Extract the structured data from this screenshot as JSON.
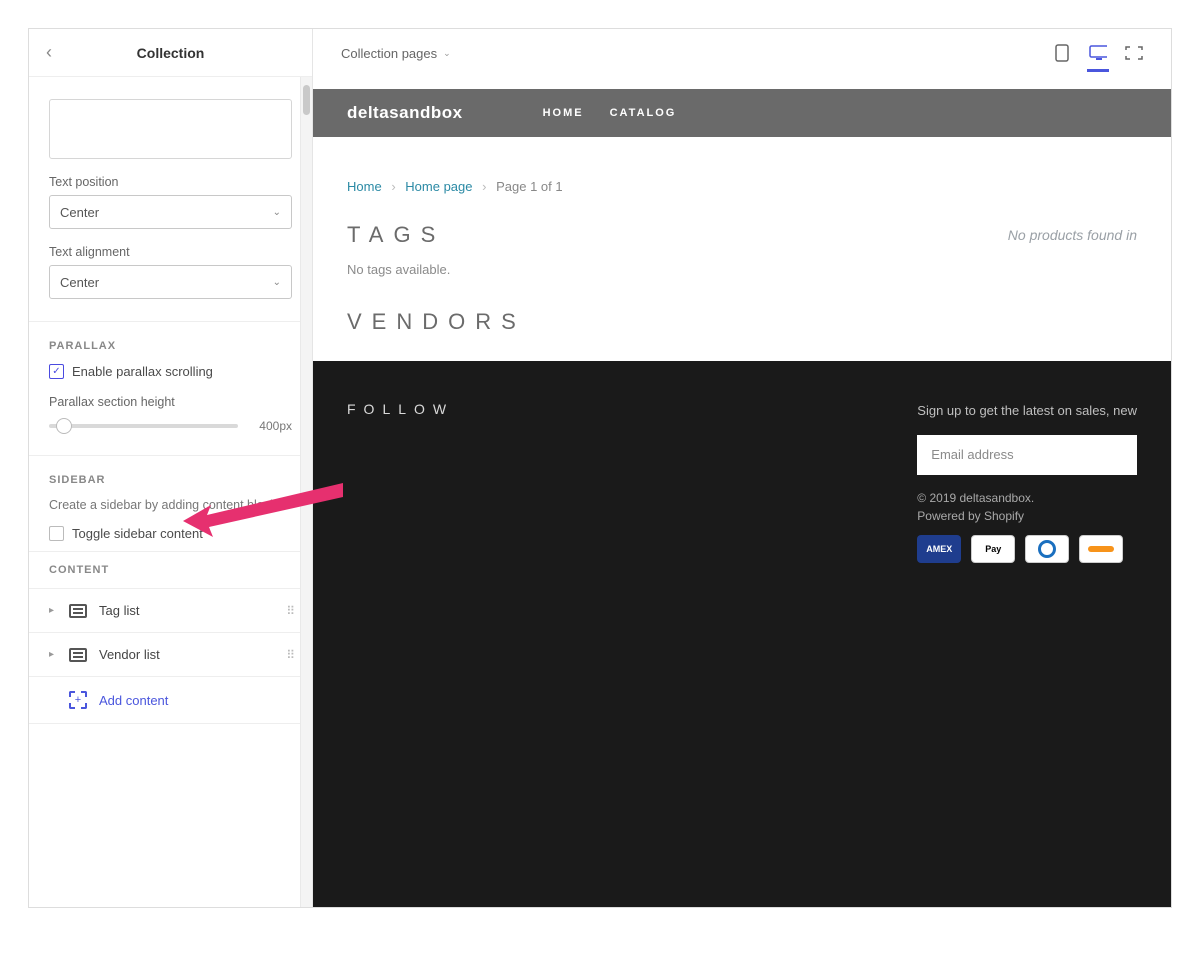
{
  "sidebar": {
    "title": "Collection",
    "text_position_label": "Text position",
    "text_position_value": "Center",
    "text_alignment_label": "Text alignment",
    "text_alignment_value": "Center",
    "parallax_heading": "PARALLAX",
    "parallax_checkbox": "Enable parallax scrolling",
    "parallax_height_label": "Parallax section height",
    "parallax_height_value": "400px",
    "sidebar_heading": "SIDEBAR",
    "sidebar_desc": "Create a sidebar by adding content blocks.",
    "toggle_sidebar": "Toggle sidebar content",
    "content_heading": "CONTENT",
    "items": [
      {
        "label": "Tag list"
      },
      {
        "label": "Vendor list"
      }
    ],
    "add_content": "Add content"
  },
  "topbar": {
    "page_selector": "Collection pages"
  },
  "preview": {
    "logo": "deltasandbox",
    "nav": {
      "home": "HOME",
      "catalog": "CATALOG"
    },
    "breadcrumb": {
      "home": "Home",
      "page": "Home page",
      "rest": "Page 1 of 1"
    },
    "tags_heading": "TAGS",
    "no_products": "No products found in",
    "no_tags": "No tags available.",
    "vendors_heading": "VENDORS",
    "footer": {
      "follow": "FOLLOW",
      "signup": "Sign up to get the latest on sales, new",
      "email_placeholder": "Email address",
      "copyright": "© 2019 deltasandbox.",
      "powered": "Powered by Shopify",
      "pay_amex": "AMEX",
      "pay_apple": "\u0000Pay"
    }
  }
}
